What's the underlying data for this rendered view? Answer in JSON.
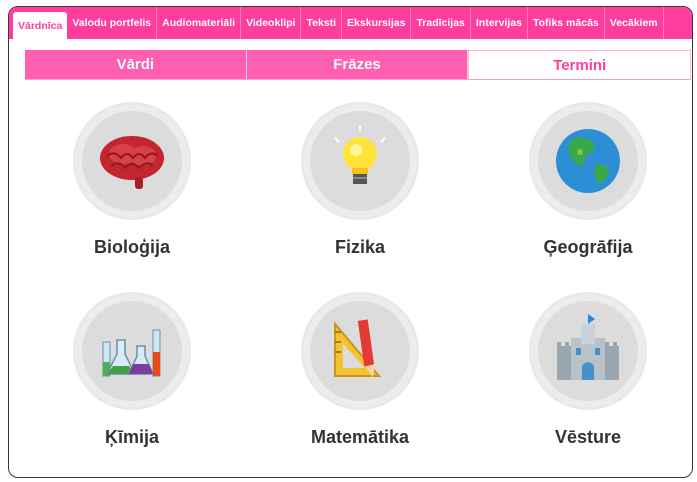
{
  "topnav": {
    "items": [
      {
        "label": "Vārdnīca",
        "active": true
      },
      {
        "label": "Valodu portfelis"
      },
      {
        "label": "Audiomateriāli"
      },
      {
        "label": "Videoklipi"
      },
      {
        "label": "Teksti"
      },
      {
        "label": "Ekskursijas"
      },
      {
        "label": "Tradīcijas"
      },
      {
        "label": "Intervijas"
      },
      {
        "label": "Tofiks mācās"
      },
      {
        "label": "Vecākiem"
      }
    ]
  },
  "subtabs": {
    "items": [
      {
        "label": "Vārdi"
      },
      {
        "label": "Frāzes"
      },
      {
        "label": "Termini",
        "active": true
      }
    ]
  },
  "subjects": [
    {
      "label": "Bioloģija",
      "icon": "brain-icon"
    },
    {
      "label": "Fizika",
      "icon": "lightbulb-icon"
    },
    {
      "label": "Ģeogrāfija",
      "icon": "globe-icon"
    },
    {
      "label": "Ķīmija",
      "icon": "flasks-icon"
    },
    {
      "label": "Matemātika",
      "icon": "ruler-pencil-icon"
    },
    {
      "label": "Vēsture",
      "icon": "castle-icon"
    }
  ],
  "colors": {
    "accent": "#ff3d9e",
    "tab": "#ff5fb0",
    "circle": "#dcdcdc"
  }
}
